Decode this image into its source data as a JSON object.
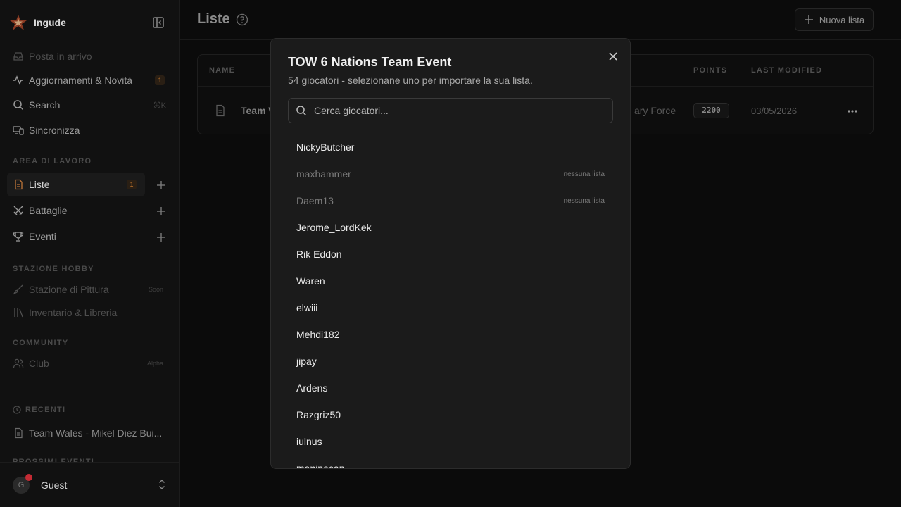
{
  "app": {
    "name": "Ingude"
  },
  "sidebar": {
    "top_items": [
      {
        "label": "Posta in arrivo"
      },
      {
        "label": "Aggiornamenti & Novità",
        "badge": "1"
      },
      {
        "label": "Search",
        "shortcut": "⌘K"
      },
      {
        "label": "Sincronizza"
      }
    ],
    "workspace": {
      "label": "AREA DI LAVORO",
      "items": [
        {
          "label": "Liste",
          "badge": "1"
        },
        {
          "label": "Battaglie"
        },
        {
          "label": "Eventi"
        }
      ]
    },
    "hobby": {
      "label": "STAZIONE HOBBY",
      "items": [
        {
          "label": "Stazione di Pittura",
          "tag": "Soon"
        },
        {
          "label": "Inventario & Libreria"
        }
      ]
    },
    "community": {
      "label": "COMMUNITY",
      "items": [
        {
          "label": "Club",
          "tag": "Alpha"
        }
      ]
    },
    "recent": {
      "label": "RECENTI",
      "items": [
        {
          "label": "Team Wales - Mikel Diez Bui..."
        }
      ]
    },
    "upcoming_label": "PROSSIMI EVENTI",
    "user": {
      "initial": "G",
      "name": "Guest"
    }
  },
  "main": {
    "title": "Liste",
    "new_list_label": "Nuova lista",
    "table": {
      "headers": {
        "name": "NAME",
        "points": "POINTS",
        "last_modified": "LAST MODIFIED"
      },
      "rows": [
        {
          "name": "Team W",
          "faction": "ary Force",
          "points": "2200",
          "date": "03/05/2026"
        }
      ]
    }
  },
  "modal": {
    "title": "TOW 6 Nations Team Event",
    "subtitle": "54 giocatori - selezionane uno per importare la sua lista.",
    "search_placeholder": "Cerca giocatori...",
    "players": [
      {
        "name": "NickyButcher",
        "note": ""
      },
      {
        "name": "maxhammer",
        "note": "nessuna lista"
      },
      {
        "name": "Daem13",
        "note": "nessuna lista"
      },
      {
        "name": "Jerome_LordKek",
        "note": ""
      },
      {
        "name": "Rik Eddon",
        "note": ""
      },
      {
        "name": "Waren",
        "note": ""
      },
      {
        "name": "elwiii",
        "note": ""
      },
      {
        "name": "Mehdi182",
        "note": ""
      },
      {
        "name": "jipay",
        "note": ""
      },
      {
        "name": "Ardens",
        "note": ""
      },
      {
        "name": "Razgriz50",
        "note": ""
      },
      {
        "name": "iulnus",
        "note": ""
      },
      {
        "name": "manipacan",
        "note": ""
      }
    ]
  },
  "colors": {
    "background": "#0b0b0b",
    "sidebar": "#111111",
    "modal": "#1b1b1b",
    "accent": "#b8702a",
    "notification": "#c42b34"
  }
}
